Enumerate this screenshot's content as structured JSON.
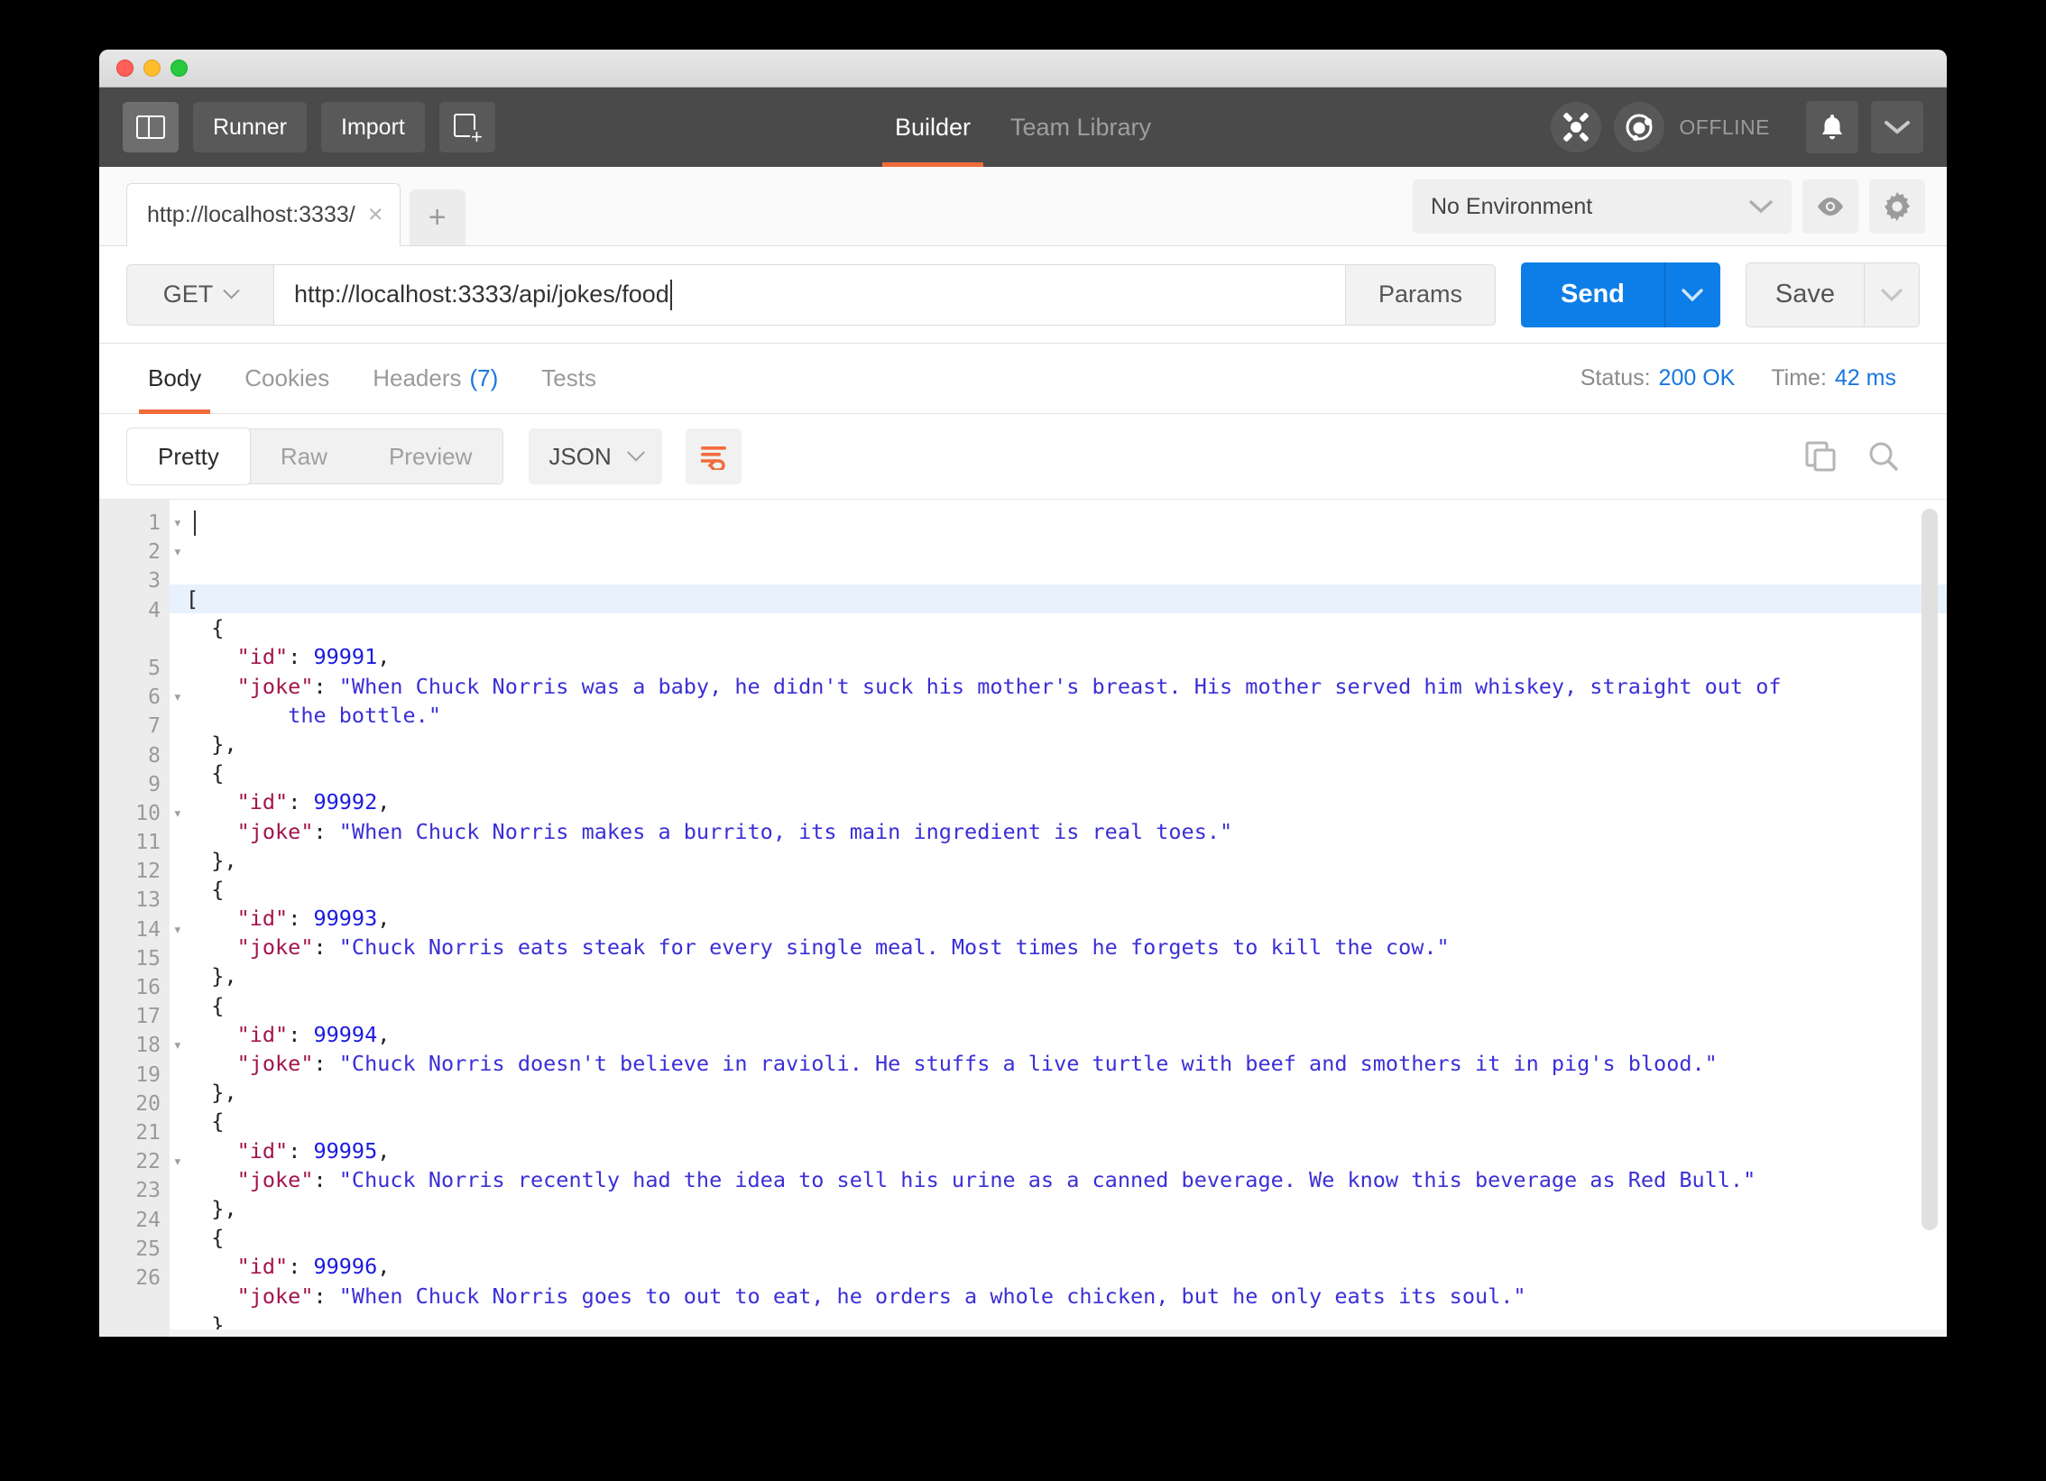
{
  "window": {
    "traffic_lights": [
      "close",
      "minimize",
      "zoom"
    ]
  },
  "topbar": {
    "sidebar_toggle": "sidebar-toggle",
    "runner_label": "Runner",
    "import_label": "Import",
    "new_tab_label": "new-request",
    "tabs": [
      {
        "label": "Builder",
        "active": true
      },
      {
        "label": "Team Library",
        "active": false
      }
    ],
    "sync_icon": "interceptor-icon",
    "status_icon": "sync-status-icon",
    "status_label": "OFFLINE",
    "bell_label": "notifications",
    "caret_label": "account-menu",
    "accent_color": "#f26b3a",
    "bar_color": "#4a4a4a"
  },
  "tabstrip": {
    "request_tabs": [
      {
        "label": "http://localhost:3333/",
        "active": true
      }
    ],
    "add_tab_label": "+",
    "close_label": "×"
  },
  "environment": {
    "selected": "No Environment",
    "eye_label": "quick-look",
    "gear_label": "manage-environments"
  },
  "request": {
    "method": "GET",
    "url": "http://localhost:3333/api/jokes/food",
    "params_label": "Params",
    "send_label": "Send",
    "save_label": "Save",
    "send_color": "#0d7ee8"
  },
  "response": {
    "tabs": [
      {
        "label": "Body",
        "count": "",
        "active": true
      },
      {
        "label": "Cookies",
        "count": "",
        "active": false
      },
      {
        "label": "Headers",
        "count": "(7)",
        "active": false
      },
      {
        "label": "Tests",
        "count": "",
        "active": false
      }
    ],
    "status_label": "Status:",
    "status_value": "200 OK",
    "time_label": "Time:",
    "time_value": "42 ms",
    "meta_color": "#1877e0"
  },
  "body_toolbar": {
    "formats": [
      {
        "label": "Pretty",
        "active": true
      },
      {
        "label": "Raw",
        "active": false
      },
      {
        "label": "Preview",
        "active": false
      }
    ],
    "language": "JSON",
    "wrap_label": "word-wrap",
    "copy_label": "copy-to-clipboard",
    "search_label": "search-body"
  },
  "code": {
    "syntax_colors": {
      "key": "#a3144b",
      "number": "#1a1ae0",
      "string": "#3b2fd6",
      "punctuation": "#222222",
      "gutter_bg": "#ececec",
      "highlight_row": "#e8f2fd"
    },
    "lines": [
      {
        "n": "1",
        "fold": true,
        "indent": 0,
        "segments": [
          {
            "t": "[",
            "c": "punct"
          }
        ]
      },
      {
        "n": "2",
        "fold": true,
        "indent": 1,
        "segments": [
          {
            "t": "{",
            "c": "punct"
          }
        ]
      },
      {
        "n": "3",
        "fold": false,
        "indent": 2,
        "segments": [
          {
            "t": "\"id\"",
            "c": "key"
          },
          {
            "t": ": ",
            "c": "punct"
          },
          {
            "t": "99991",
            "c": "num"
          },
          {
            "t": ",",
            "c": "punct"
          }
        ]
      },
      {
        "n": "4",
        "fold": false,
        "indent": 2,
        "segments": [
          {
            "t": "\"joke\"",
            "c": "key"
          },
          {
            "t": ": ",
            "c": "punct"
          },
          {
            "t": "\"When Chuck Norris was a baby, he didn't suck his mother's breast. His mother served him whiskey, straight out of",
            "c": "str"
          }
        ]
      },
      {
        "n": "",
        "fold": false,
        "indent": 4,
        "segments": [
          {
            "t": "the bottle.\"",
            "c": "str"
          }
        ]
      },
      {
        "n": "5",
        "fold": false,
        "indent": 1,
        "segments": [
          {
            "t": "},",
            "c": "punct"
          }
        ]
      },
      {
        "n": "6",
        "fold": true,
        "indent": 1,
        "segments": [
          {
            "t": "{",
            "c": "punct"
          }
        ]
      },
      {
        "n": "7",
        "fold": false,
        "indent": 2,
        "segments": [
          {
            "t": "\"id\"",
            "c": "key"
          },
          {
            "t": ": ",
            "c": "punct"
          },
          {
            "t": "99992",
            "c": "num"
          },
          {
            "t": ",",
            "c": "punct"
          }
        ]
      },
      {
        "n": "8",
        "fold": false,
        "indent": 2,
        "segments": [
          {
            "t": "\"joke\"",
            "c": "key"
          },
          {
            "t": ": ",
            "c": "punct"
          },
          {
            "t": "\"When Chuck Norris makes a burrito, its main ingredient is real toes.\"",
            "c": "str"
          }
        ]
      },
      {
        "n": "9",
        "fold": false,
        "indent": 1,
        "segments": [
          {
            "t": "},",
            "c": "punct"
          }
        ]
      },
      {
        "n": "10",
        "fold": true,
        "indent": 1,
        "segments": [
          {
            "t": "{",
            "c": "punct"
          }
        ]
      },
      {
        "n": "11",
        "fold": false,
        "indent": 2,
        "segments": [
          {
            "t": "\"id\"",
            "c": "key"
          },
          {
            "t": ": ",
            "c": "punct"
          },
          {
            "t": "99993",
            "c": "num"
          },
          {
            "t": ",",
            "c": "punct"
          }
        ]
      },
      {
        "n": "12",
        "fold": false,
        "indent": 2,
        "segments": [
          {
            "t": "\"joke\"",
            "c": "key"
          },
          {
            "t": ": ",
            "c": "punct"
          },
          {
            "t": "\"Chuck Norris eats steak for every single meal. Most times he forgets to kill the cow.\"",
            "c": "str"
          }
        ]
      },
      {
        "n": "13",
        "fold": false,
        "indent": 1,
        "segments": [
          {
            "t": "},",
            "c": "punct"
          }
        ]
      },
      {
        "n": "14",
        "fold": true,
        "indent": 1,
        "segments": [
          {
            "t": "{",
            "c": "punct"
          }
        ]
      },
      {
        "n": "15",
        "fold": false,
        "indent": 2,
        "segments": [
          {
            "t": "\"id\"",
            "c": "key"
          },
          {
            "t": ": ",
            "c": "punct"
          },
          {
            "t": "99994",
            "c": "num"
          },
          {
            "t": ",",
            "c": "punct"
          }
        ]
      },
      {
        "n": "16",
        "fold": false,
        "indent": 2,
        "segments": [
          {
            "t": "\"joke\"",
            "c": "key"
          },
          {
            "t": ": ",
            "c": "punct"
          },
          {
            "t": "\"Chuck Norris doesn't believe in ravioli. He stuffs a live turtle with beef and smothers it in pig's blood.\"",
            "c": "str"
          }
        ]
      },
      {
        "n": "17",
        "fold": false,
        "indent": 1,
        "segments": [
          {
            "t": "},",
            "c": "punct"
          }
        ]
      },
      {
        "n": "18",
        "fold": true,
        "indent": 1,
        "segments": [
          {
            "t": "{",
            "c": "punct"
          }
        ]
      },
      {
        "n": "19",
        "fold": false,
        "indent": 2,
        "segments": [
          {
            "t": "\"id\"",
            "c": "key"
          },
          {
            "t": ": ",
            "c": "punct"
          },
          {
            "t": "99995",
            "c": "num"
          },
          {
            "t": ",",
            "c": "punct"
          }
        ]
      },
      {
        "n": "20",
        "fold": false,
        "indent": 2,
        "segments": [
          {
            "t": "\"joke\"",
            "c": "key"
          },
          {
            "t": ": ",
            "c": "punct"
          },
          {
            "t": "\"Chuck Norris recently had the idea to sell his urine as a canned beverage. We know this beverage as Red Bull.\"",
            "c": "str"
          }
        ]
      },
      {
        "n": "21",
        "fold": false,
        "indent": 1,
        "segments": [
          {
            "t": "},",
            "c": "punct"
          }
        ]
      },
      {
        "n": "22",
        "fold": true,
        "indent": 1,
        "segments": [
          {
            "t": "{",
            "c": "punct"
          }
        ]
      },
      {
        "n": "23",
        "fold": false,
        "indent": 2,
        "segments": [
          {
            "t": "\"id\"",
            "c": "key"
          },
          {
            "t": ": ",
            "c": "punct"
          },
          {
            "t": "99996",
            "c": "num"
          },
          {
            "t": ",",
            "c": "punct"
          }
        ]
      },
      {
        "n": "24",
        "fold": false,
        "indent": 2,
        "segments": [
          {
            "t": "\"joke\"",
            "c": "key"
          },
          {
            "t": ": ",
            "c": "punct"
          },
          {
            "t": "\"When Chuck Norris goes to out to eat, he orders a whole chicken, but he only eats its soul.\"",
            "c": "str"
          }
        ]
      },
      {
        "n": "25",
        "fold": false,
        "indent": 1,
        "segments": [
          {
            "t": "}",
            "c": "punct"
          }
        ]
      },
      {
        "n": "26",
        "fold": false,
        "indent": 0,
        "segments": [
          {
            "t": "]",
            "c": "punct"
          }
        ]
      }
    ]
  }
}
